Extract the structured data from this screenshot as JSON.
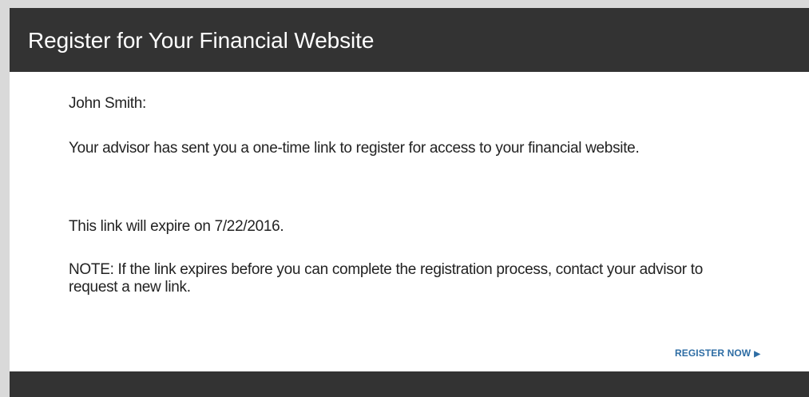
{
  "header": {
    "title": "Register for Your Financial Website"
  },
  "body": {
    "greeting": "John Smith:",
    "paragraph1": "Your advisor  has sent you a one-time link to register for access to your financial website.",
    "paragraph2": "This link will expire on 7/22/2016.",
    "paragraph3": "NOTE: If the link expires before you can complete the registration process, contact your advisor to request a new link."
  },
  "actions": {
    "register_label": "REGISTER NOW",
    "register_arrow": "▶"
  },
  "colors": {
    "header_bg": "#333333",
    "link": "#2e6da4",
    "page_bg": "#d9d9d9"
  }
}
